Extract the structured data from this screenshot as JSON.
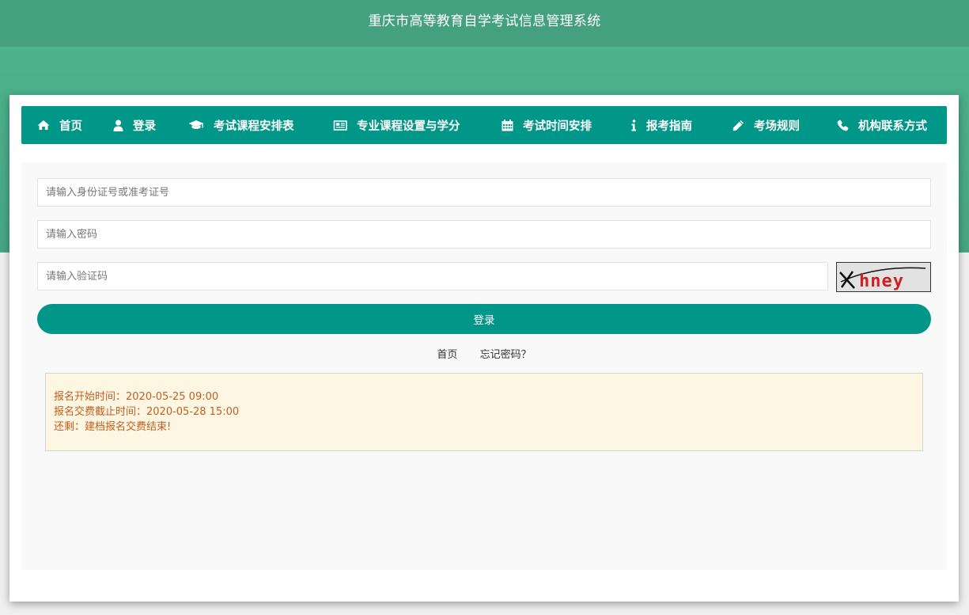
{
  "header": {
    "title": "重庆市高等教育自学考试信息管理系统"
  },
  "nav": {
    "items": [
      {
        "label": "首页",
        "icon": "home-icon"
      },
      {
        "label": "登录",
        "icon": "user-icon"
      },
      {
        "label": "考试课程安排表",
        "icon": "graduation-cap-icon"
      },
      {
        "label": "专业课程设置与学分",
        "icon": "newspaper-icon"
      },
      {
        "label": "考试时间安排",
        "icon": "calendar-icon"
      },
      {
        "label": "报考指南",
        "icon": "info-icon"
      },
      {
        "label": "考场规则",
        "icon": "pencil-icon"
      },
      {
        "label": "机构联系方式",
        "icon": "phone-icon"
      }
    ]
  },
  "form": {
    "id_placeholder": "请输入身份证号或准考证号",
    "password_placeholder": "请输入密码",
    "captcha_placeholder": "请输入验证码",
    "captcha_text": "hney",
    "login_label": "登录"
  },
  "links": {
    "home": "首页",
    "forgot": "忘记密码？"
  },
  "notice": {
    "line1": "报名开始时间：2020-05-25 09:00",
    "line2": "报名交费截止时间：2020-05-28 15:00",
    "line3": "还剩：建档报名交费结束!"
  },
  "colors": {
    "header_bg": "#45a07f",
    "band_bg": "#4db38c",
    "primary": "#009688",
    "notice_bg": "#fdf6e3",
    "notice_text": "#c35e1f"
  }
}
